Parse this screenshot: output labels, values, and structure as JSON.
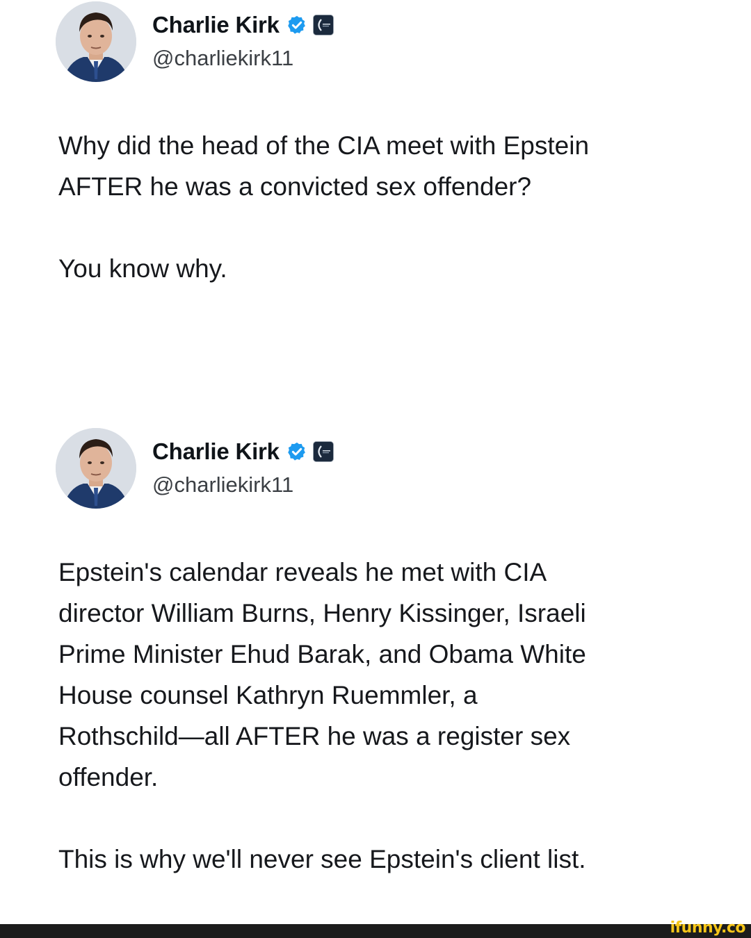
{
  "tweets": [
    {
      "author": {
        "display_name": "Charlie Kirk",
        "handle": "@charliekirk11"
      },
      "paragraphs": [
        "Why did the head of the CIA meet with Epstein\nAFTER he was a convicted sex offender?",
        "You know why."
      ]
    },
    {
      "author": {
        "display_name": "Charlie Kirk",
        "handle": "@charliekirk11"
      },
      "paragraphs": [
        "Epstein's calendar reveals he met with CIA\ndirector William Burns, Henry Kissinger, Israeli\nPrime Minister Ehud Barak, and Obama White\nHouse counsel Kathryn Ruemmler, a\nRothschild—all AFTER he was a register sex\noffender.",
        "This is why we'll never see Epstein's client list."
      ]
    }
  ],
  "watermark": "ifunny.co",
  "icons": {
    "verified": "verified-badge-icon",
    "affiliate": "affiliate-badge-icon"
  },
  "colors": {
    "verified_blue": "#1d9bf0",
    "text": "#0f1419",
    "handle": "#3b3f44",
    "watermark": "#f5c518",
    "footer_bar": "#1c1c1c"
  }
}
